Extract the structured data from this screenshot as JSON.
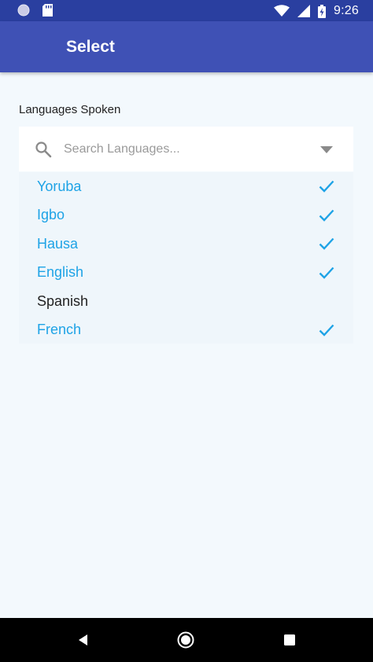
{
  "status_bar": {
    "time": "9:26",
    "icons": [
      "notification-dot-icon",
      "sd-card-icon",
      "wifi-icon",
      "signal-icon",
      "battery-charging-icon"
    ]
  },
  "app_bar": {
    "title": "Select",
    "color": "#3f51b5"
  },
  "form": {
    "section_label": "Languages Spoken",
    "search": {
      "value": "",
      "placeholder": "Search Languages...",
      "icon": "search-icon",
      "dropdown_icon": "dropdown-arrow-icon"
    },
    "options": [
      {
        "label": "Yoruba",
        "selected": true
      },
      {
        "label": "Igbo",
        "selected": true
      },
      {
        "label": "Hausa",
        "selected": true
      },
      {
        "label": "English",
        "selected": true
      },
      {
        "label": "Spanish",
        "selected": false
      },
      {
        "label": "French",
        "selected": true
      }
    ]
  },
  "colors": {
    "accent": "#1ea3e6",
    "status_bar": "#2a3fa0",
    "background": "#f3f9fd"
  },
  "nav_bar": {
    "icons": [
      "back-icon",
      "home-icon",
      "recents-icon"
    ]
  }
}
